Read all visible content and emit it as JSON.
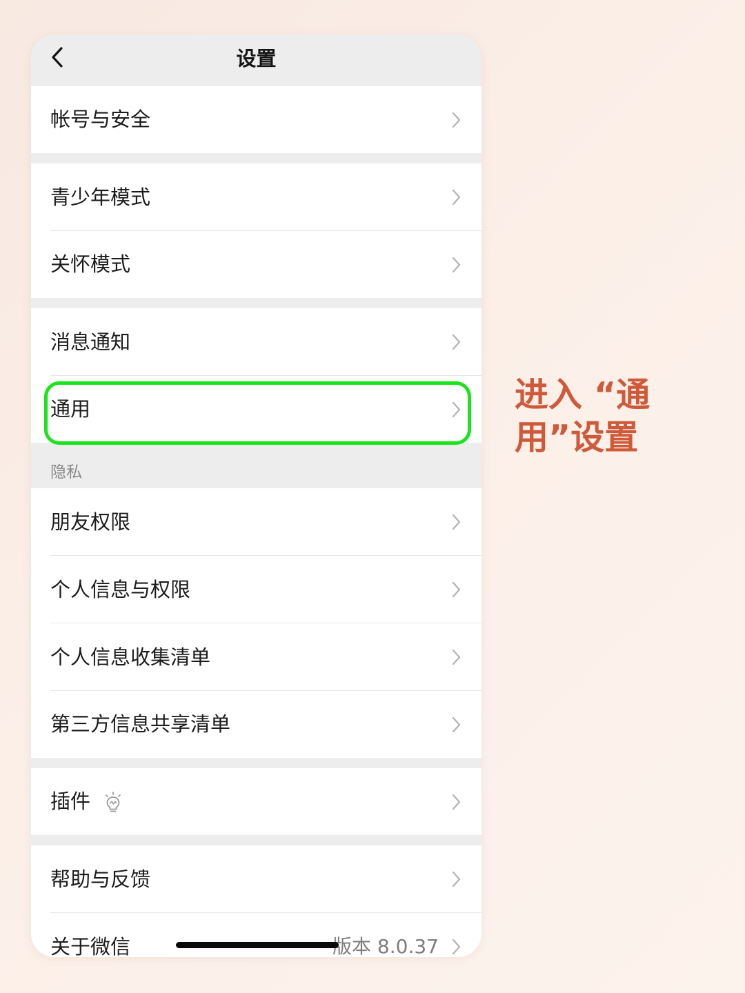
{
  "nav": {
    "title": "设置",
    "back_icon": "chevron-left-icon"
  },
  "groups": [
    {
      "items": [
        {
          "label": "帐号与安全"
        }
      ]
    },
    {
      "items": [
        {
          "label": "青少年模式"
        },
        {
          "label": "关怀模式"
        }
      ]
    },
    {
      "items": [
        {
          "label": "消息通知"
        },
        {
          "label": "通用",
          "highlighted": true
        }
      ]
    },
    {
      "title": "隐私",
      "items": [
        {
          "label": "朋友权限"
        },
        {
          "label": "个人信息与权限"
        },
        {
          "label": "个人信息收集清单"
        },
        {
          "label": "第三方信息共享清单"
        }
      ]
    },
    {
      "items": [
        {
          "label": "插件",
          "icon": "lightbulb-icon"
        }
      ]
    },
    {
      "items": [
        {
          "label": "帮助与反馈"
        },
        {
          "label": "关于微信",
          "value": "版本 8.0.37"
        }
      ]
    }
  ],
  "annotation": {
    "text": "进入 “通用”设置",
    "color": "#cf5a3a"
  },
  "colors": {
    "highlight_border": "#1be41b",
    "page_background": "#fbefe8",
    "group_separator": "#ededed"
  }
}
